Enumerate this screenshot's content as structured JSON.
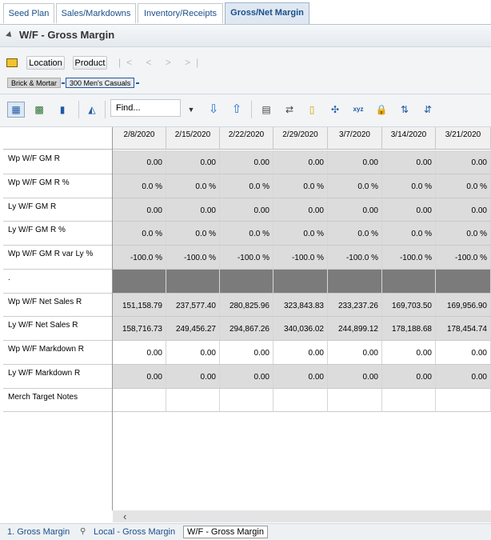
{
  "tabs": [
    "Seed Plan",
    "Sales/Markdowns",
    "Inventory/Receipts",
    "Gross/Net Margin"
  ],
  "view_title": "W/F - Gross Margin",
  "dimension_buttons": {
    "location": "Location",
    "product": "Product"
  },
  "nav_arrows": "|< < > >|",
  "filters": [
    "Brick & Mortar",
    "300 Men's Casuals"
  ],
  "toolbar": {
    "find_placeholder": "Find..."
  },
  "columns": [
    "2/8/2020",
    "2/15/2020",
    "2/22/2020",
    "2/29/2020",
    "3/7/2020",
    "3/14/2020",
    "3/21/2020"
  ],
  "rows": [
    {
      "label": "Wp W/F GM R",
      "values": [
        "0.00",
        "0.00",
        "0.00",
        "0.00",
        "0.00",
        "0.00",
        "0.00"
      ],
      "shade": "gray"
    },
    {
      "label": "Wp W/F GM R %",
      "values": [
        "0.0 %",
        "0.0 %",
        "0.0 %",
        "0.0 %",
        "0.0 %",
        "0.0 %",
        "0.0 %"
      ],
      "shade": "gray"
    },
    {
      "label": "Ly W/F GM R",
      "values": [
        "0.00",
        "0.00",
        "0.00",
        "0.00",
        "0.00",
        "0.00",
        "0.00"
      ],
      "shade": "gray"
    },
    {
      "label": "Ly W/F GM R %",
      "values": [
        "0.0 %",
        "0.0 %",
        "0.0 %",
        "0.0 %",
        "0.0 %",
        "0.0 %",
        "0.0 %"
      ],
      "shade": "gray"
    },
    {
      "label": "Wp W/F GM R var Ly %",
      "values": [
        "-100.0 %",
        "-100.0 %",
        "-100.0 %",
        "-100.0 %",
        "-100.0 %",
        "-100.0 %",
        "-100.0 %"
      ],
      "shade": "gray"
    },
    {
      "label": ".",
      "values": [
        "",
        "",
        "",
        "",
        "",
        "",
        ""
      ],
      "shade": "dark"
    },
    {
      "label": "Wp W/F Net Sales R",
      "values": [
        "151,158.79",
        "237,577.40",
        "280,825.96",
        "323,843.83",
        "233,237.26",
        "169,703.50",
        "169,956.90"
      ],
      "shade": "gray"
    },
    {
      "label": "Ly W/F Net Sales R",
      "values": [
        "158,716.73",
        "249,456.27",
        "294,867.26",
        "340,036.02",
        "244,899.12",
        "178,188.68",
        "178,454.74"
      ],
      "shade": "gray"
    },
    {
      "label": "Wp W/F Markdown R",
      "values": [
        "0.00",
        "0.00",
        "0.00",
        "0.00",
        "0.00",
        "0.00",
        "0.00"
      ],
      "shade": "white"
    },
    {
      "label": "Ly W/F Markdown R",
      "values": [
        "0.00",
        "0.00",
        "0.00",
        "0.00",
        "0.00",
        "0.00",
        "0.00"
      ],
      "shade": "gray"
    },
    {
      "label": "Merch Target Notes",
      "values": [
        "",
        "",
        "",
        "",
        "",
        "",
        ""
      ],
      "shade": "white"
    }
  ],
  "bottom_tabs": [
    "1. Gross Margin",
    "Local - Gross Margin",
    "W/F - Gross Margin"
  ],
  "colors": {
    "gray_cell": "#dcdcdc",
    "dark_cell": "#7b7b7b",
    "tab_text": "#1a4f8a"
  }
}
